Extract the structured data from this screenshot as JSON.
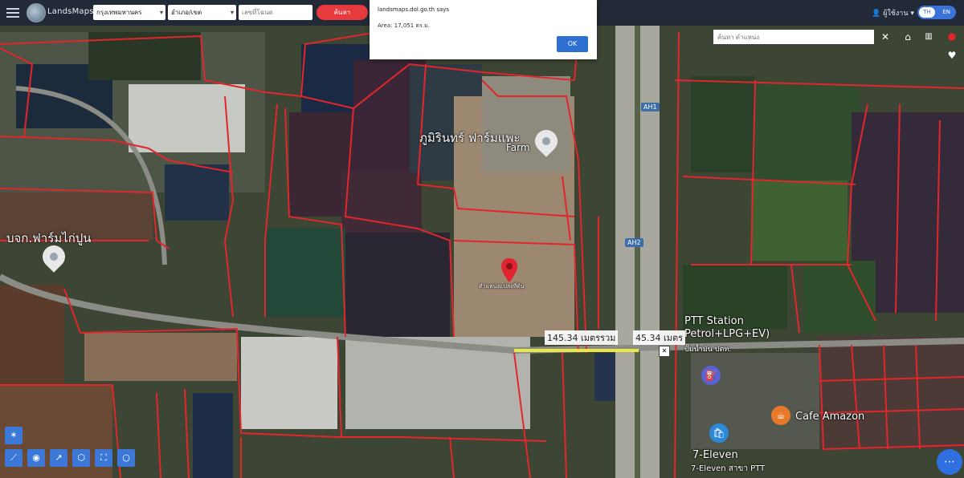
{
  "header": {
    "brand": "LandsMaps",
    "province_select": "กรุงเทพมหานคร",
    "district_select": "อำเภอ/เขต",
    "search_placeholder": "เลขที่โฉนด",
    "search_button": "ค้นหา",
    "user_label": "ผู้ใช้งาน",
    "lang_active": "TH",
    "lang_alt": "EN"
  },
  "dialog": {
    "title": "landsmaps.dol.go.th says",
    "message": "Area: 17,051 ตร.ม.",
    "ok_label": "OK"
  },
  "map": {
    "coord_placeholder": "ค้นหา ตำแหน่ง",
    "labels": {
      "farm_name": "ภูมิรินทร์ ฟาร์มแพะ",
      "farm_sub": "Farm",
      "west_poi": "บจก.ฟาร์มไก่ปูน",
      "pin_label": "ตำแหน่งแปลงที่ดิน",
      "ptt_name": "PTT Station",
      "ptt_sub": "Petrol+LPG+EV)",
      "ptt_thai": "ปั๊มน้ำมัน ปตท.",
      "cafe": "Cafe Amazon",
      "seven_name": "7-Eleven",
      "seven_sub": "7-Eleven สาขา PTT"
    },
    "road_shields": [
      "AH1",
      "AH2"
    ],
    "measure": {
      "total": "145.34 เมตรรวม",
      "segment": "45.34 เมตร"
    }
  },
  "colors": {
    "parcel_line": "#e2262b",
    "measure_line": "#e8e84a",
    "accent": "#3b78d8",
    "search_button": "#e63a3f"
  },
  "icons": {
    "menu": "menu-icon",
    "logo": "globe-logo-icon",
    "user": "user-icon",
    "close": "close-icon",
    "home": "home-icon",
    "layers": "layers-icon",
    "heart": "heart-icon",
    "ruler": "ruler-icon",
    "gps": "location-icon",
    "fuel": "fuel-icon",
    "cafe": "cafe-icon",
    "shop": "shop-icon"
  }
}
